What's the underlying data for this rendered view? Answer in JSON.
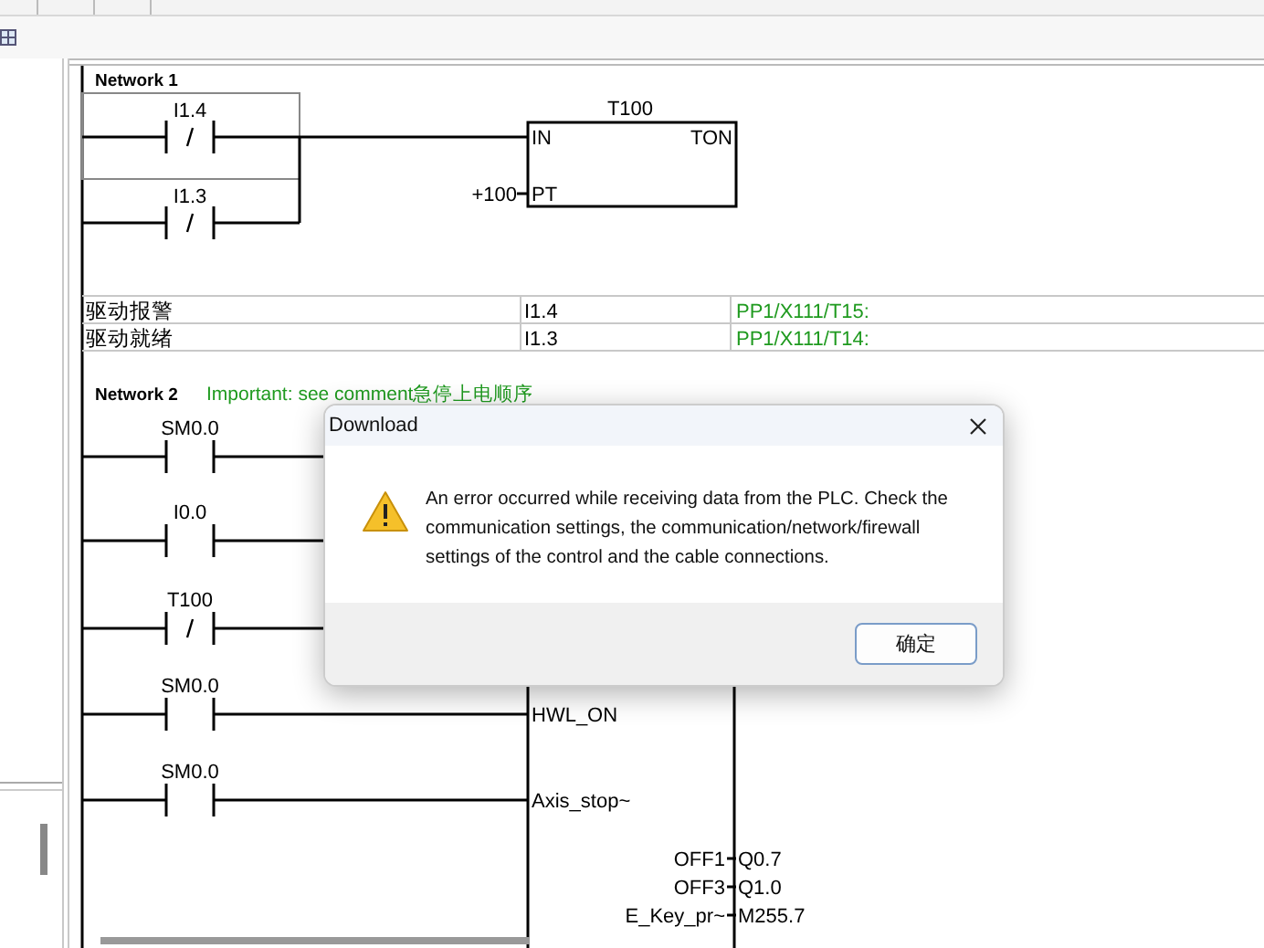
{
  "network1": {
    "title": "Network 1",
    "contacts": [
      {
        "address": "I1.4",
        "negated": true
      },
      {
        "address": "I1.3",
        "negated": true
      }
    ],
    "timer": {
      "name": "T100",
      "type": "TON",
      "in_pin": "IN",
      "pt_pin": "PT",
      "preset": "+100"
    }
  },
  "symbol_table": [
    {
      "symbol": "驱动报警",
      "address": "I1.4",
      "comment": "PP1/X111/T15:"
    },
    {
      "symbol": "驱动就绪",
      "address": "I1.3",
      "comment": "PP1/X111/T14:"
    }
  ],
  "network2": {
    "title": "Network 2",
    "comment": "Important: see comment急停上电顺序",
    "contacts": [
      {
        "address": "SM0.0",
        "negated": false
      },
      {
        "address": "I0.0",
        "negated": false
      },
      {
        "address": "T100",
        "negated": true
      },
      {
        "address": "SM0.0",
        "negated": false,
        "block_input": "HWL_ON"
      },
      {
        "address": "SM0.0",
        "negated": false,
        "block_input": "Axis_stop~"
      }
    ],
    "outputs": [
      {
        "value": "OFF1",
        "pin": "Q0.7"
      },
      {
        "value": "OFF3",
        "pin": "Q1.0"
      },
      {
        "value": "E_Key_pr~",
        "pin": "M255.7"
      }
    ]
  },
  "dialog": {
    "title": "Download",
    "message": "An error occurred while receiving data from the PLC. Check the communication settings, the communication/network/firewall settings of the control and the cable connections.",
    "buttons": [
      "确定"
    ]
  }
}
